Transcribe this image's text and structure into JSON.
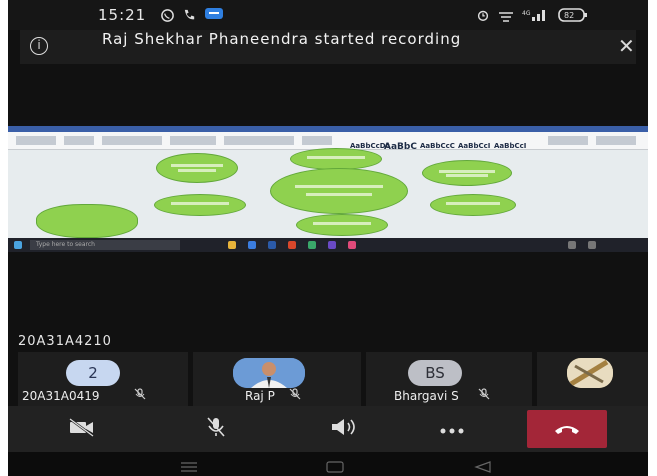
{
  "status_bar": {
    "time": "15:21",
    "left_icons": [
      "whatsapp-icon",
      "phone-icon",
      "chat-icon"
    ],
    "right_icons": [
      "alarm-icon",
      "network-icon",
      "signal-icon",
      "battery-icon"
    ],
    "battery_label": "82"
  },
  "banner": {
    "message": "Raj Shekhar Phaneendra started recording",
    "icon": "info-icon",
    "close_icon": "close-icon"
  },
  "shared_screen": {
    "style_labels": [
      "AaBbCcDc",
      "AaBbCcDc",
      "AaBbC",
      "AaBbCcC",
      "AaBbCcI",
      "AaBbCcI"
    ],
    "search_placeholder": "Type here to search",
    "bubble_color": "#8fd14f"
  },
  "speaker_label": "20A31A4210",
  "participants": [
    {
      "avatar_text": "2",
      "name": "20A31A0419",
      "avatar_color": "#c7d7f0",
      "mic_muted": true
    },
    {
      "avatar_text": "",
      "name": "Raj P",
      "avatar_color": "#5a86c5",
      "mic_muted": true,
      "has_photo": true
    },
    {
      "avatar_text": "BS",
      "name": "Bhargavi S",
      "avatar_color": "#bdbfc6",
      "mic_muted": true
    },
    {
      "avatar_text": "",
      "name": "",
      "avatar_color": "#b99d5b",
      "mic_muted": false,
      "has_photo": true
    }
  ],
  "controls": {
    "camera": "camera-off-icon",
    "mic": "mic-off-icon",
    "speaker": "speaker-icon",
    "more": "more-icon",
    "end_call": "end-call-icon",
    "end_call_color": "#a32638"
  },
  "nav_bar": [
    "menu-icon",
    "home-icon",
    "back-icon"
  ]
}
